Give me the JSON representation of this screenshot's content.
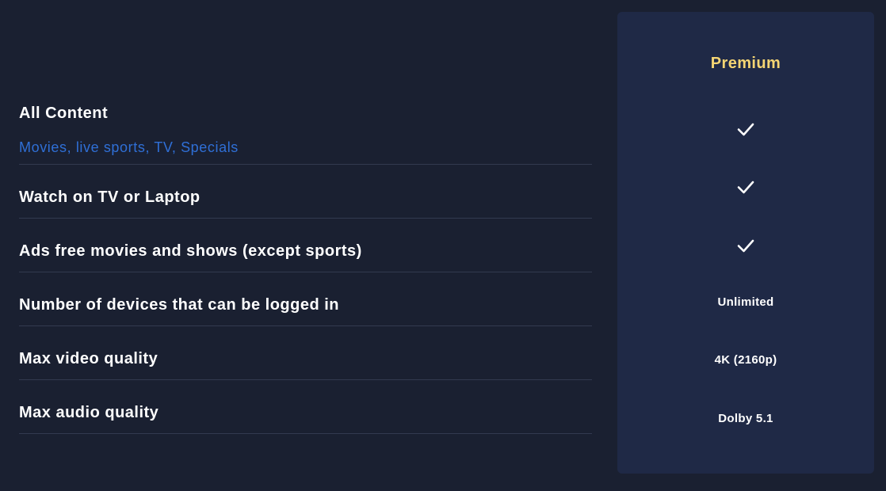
{
  "plan": {
    "name": "Premium",
    "accent_color": "#f5d573"
  },
  "features": [
    {
      "title": "All Content",
      "subtitle": "Movies, live sports, TV, Specials",
      "value_icon": "check-icon"
    },
    {
      "title": "Watch on TV or Laptop",
      "value_icon": "check-icon"
    },
    {
      "title": "Ads free movies and shows (except sports)",
      "value_icon": "check-icon"
    },
    {
      "title": "Number of devices that can be logged in",
      "value": "Unlimited"
    },
    {
      "title": "Max video quality",
      "value": "4K (2160p)"
    },
    {
      "title": "Max audio quality",
      "value": "Dolby 5.1"
    }
  ],
  "colors": {
    "background": "#1a2031",
    "card": "#1f2946",
    "subtitle_link": "#2f6fd6",
    "divider": "#323a4f"
  }
}
